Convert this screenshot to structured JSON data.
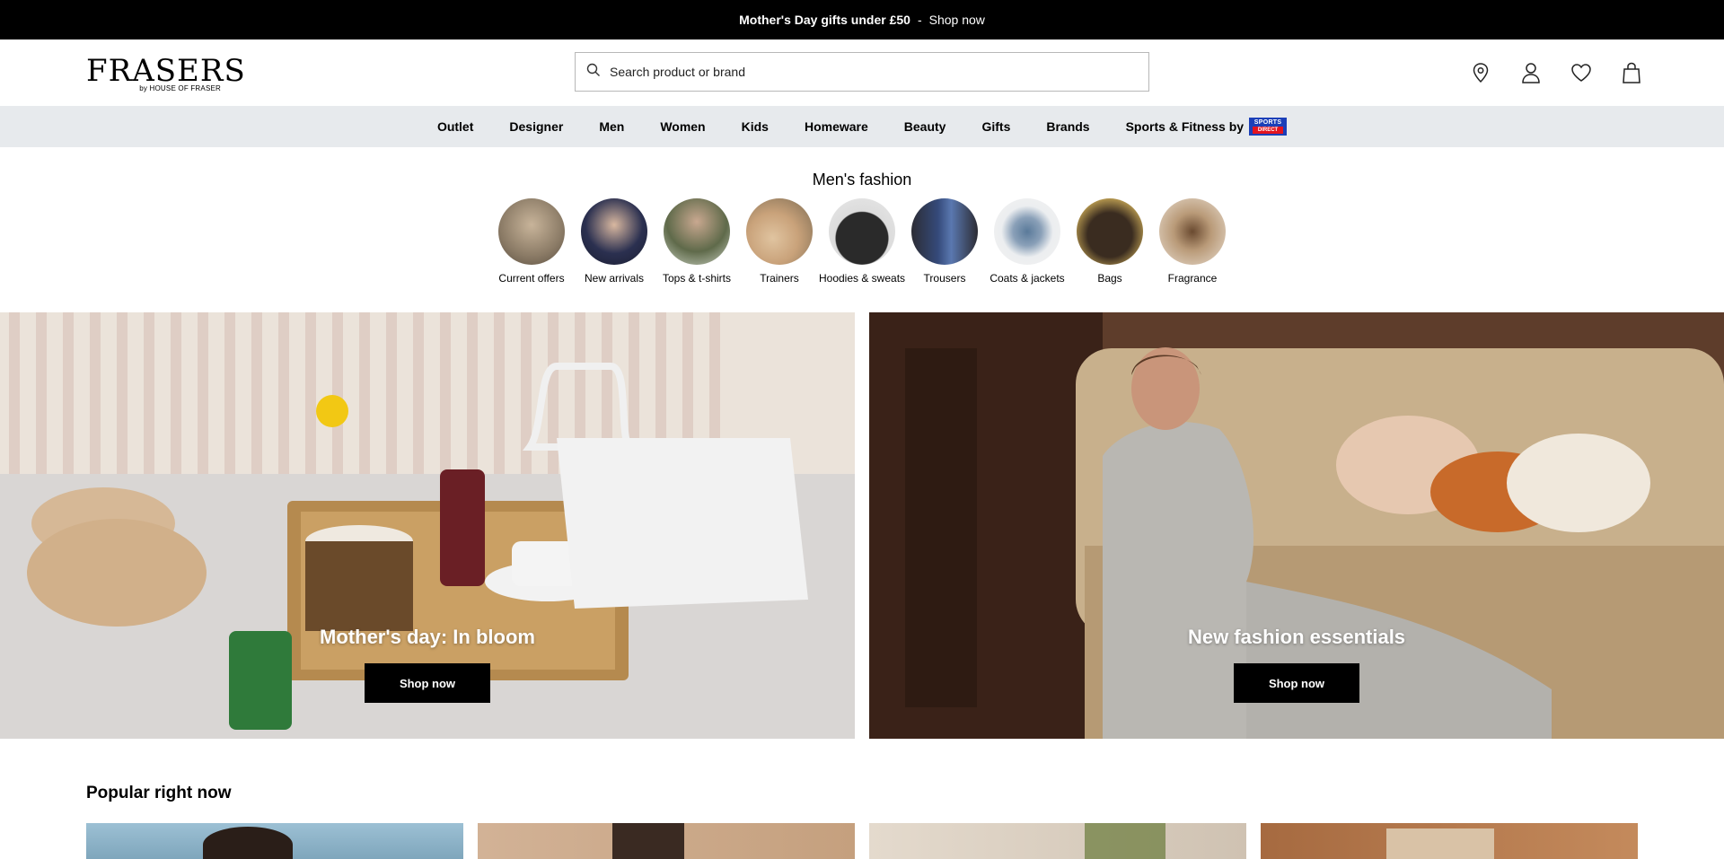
{
  "promo": {
    "text": "Mother's Day gifts under £50",
    "separator": "-",
    "link": "Shop now"
  },
  "header": {
    "logo_main": "FRASERS",
    "logo_sub": "by HOUSE OF FRASER",
    "search_placeholder": "Search product or brand",
    "icons": [
      "location-icon",
      "account-icon",
      "wishlist-icon",
      "bag-icon"
    ]
  },
  "nav": {
    "items": [
      "Outlet",
      "Designer",
      "Men",
      "Women",
      "Kids",
      "Homeware",
      "Beauty",
      "Gifts",
      "Brands",
      "Sports & Fitness by"
    ],
    "badge_top": "SPORTS",
    "badge_bottom": "DIRECT"
  },
  "categories": {
    "title": "Men's fashion",
    "items": [
      {
        "label": "Current offers",
        "color": "#8b7b66"
      },
      {
        "label": "New arrivals",
        "color": "#2b3050"
      },
      {
        "label": "Tops & t-shirts",
        "color": "#5f6a4a"
      },
      {
        "label": "Trainers",
        "color": "#c9a27a"
      },
      {
        "label": "Hoodies & sweats",
        "color": "#2a2a2a"
      },
      {
        "label": "Trousers",
        "color": "#354a7a"
      },
      {
        "label": "Coats & jackets",
        "color": "#d7dce2"
      },
      {
        "label": "Bags",
        "color": "#3a2c20"
      },
      {
        "label": "Fragrance",
        "color": "#b99a78"
      }
    ]
  },
  "heroes": [
    {
      "caption": "Mother's day: In bloom",
      "cta": "Shop now"
    },
    {
      "caption": "New fashion essentials",
      "cta": "Shop now"
    }
  ],
  "popular": {
    "title": "Popular right now",
    "tiles": [
      {
        "color": "#8fb4c8"
      },
      {
        "color": "#c9a98a"
      },
      {
        "color": "#d8cdbf"
      },
      {
        "color": "#b07a50"
      }
    ]
  }
}
